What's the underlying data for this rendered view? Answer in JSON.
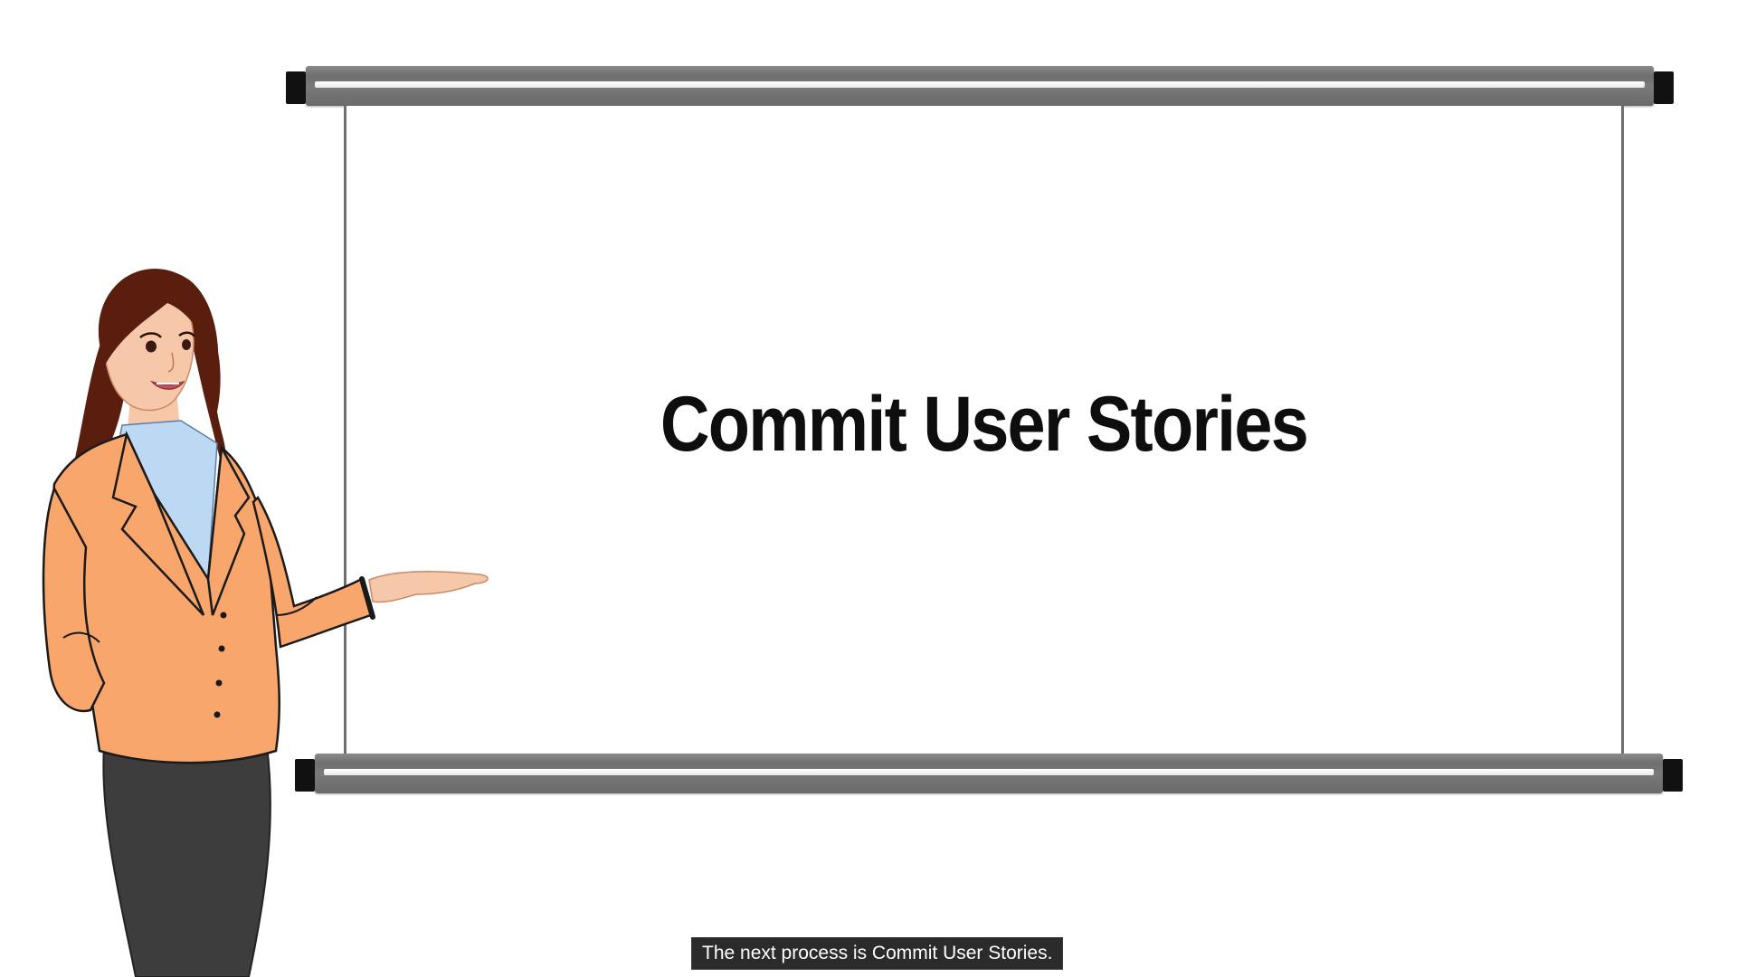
{
  "slide": {
    "title": "Commit User Stories"
  },
  "caption": {
    "text": "The next process is Commit User Stories."
  },
  "colors": {
    "background": "#ffffff",
    "roller": "#767676",
    "roller_caps": "#111111",
    "title_text": "#0e0e0e",
    "caption_bg": "#2b2b2b",
    "caption_text": "#ffffff",
    "jacket": "#f9a66c",
    "skirt": "#3d3d3d",
    "hair": "#5a1e0e",
    "shirt": "#bcd8f2"
  },
  "illustration": {
    "presenter": "woman-presenter-pointing-at-screen"
  }
}
